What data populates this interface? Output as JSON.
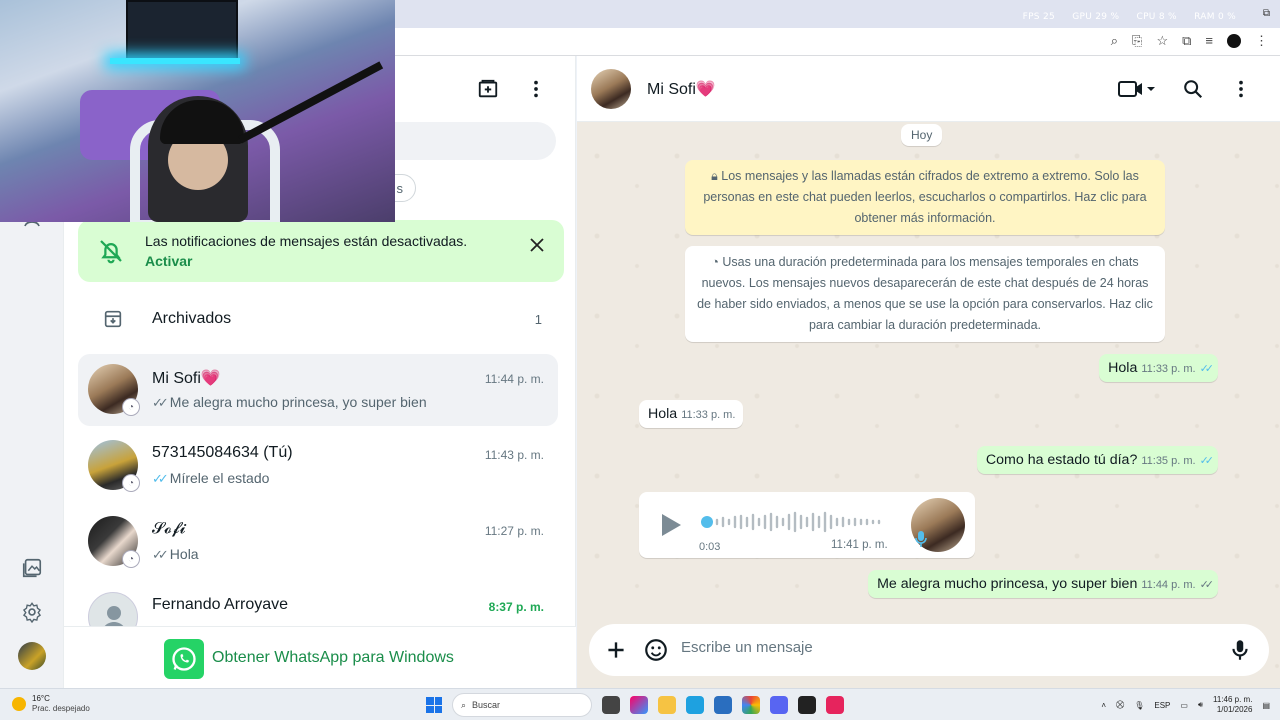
{
  "perf": {
    "fps": "FPS 25",
    "gpu": "GPU 29 %",
    "cpu": "CPU 8 %",
    "ram": "RAM 0 %"
  },
  "sidebar": {
    "active_chat_status": ""
  },
  "list": {
    "filter_chip": "s",
    "notification": {
      "text": "Las notificaciones de mensajes están desactivadas.",
      "action": "Activar"
    },
    "archived": {
      "label": "Archivados",
      "count": "1"
    },
    "chats": [
      {
        "name": "Mi Sofi💗",
        "time": "11:44 p. m.",
        "preview": "Me alegra mucho princesa, yo super bien",
        "ticks": "gray"
      },
      {
        "name": "573145084634 (Tú)",
        "time": "11:43 p. m.",
        "preview": "Mírele el estado",
        "ticks": "blue"
      },
      {
        "name": "𝓢𝓸𝓯𝓲",
        "time": "11:27 p. m.",
        "preview": "Hola",
        "ticks": "gray"
      },
      {
        "name": "Fernando Arroyave",
        "time": "8:37 p. m.",
        "preview": "",
        "ticks": ""
      }
    ],
    "get_whatsapp": "Obtener WhatsApp para Windows"
  },
  "conversation": {
    "contact_name": "Mi Sofi💗",
    "day": "Hoy",
    "encryption_note": "Los mensajes y las llamadas están cifrados de extremo a extremo. Solo las personas en este chat pueden leerlos, escucharlos o compartirlos. Haz clic para obtener más información.",
    "temporary_note": "Usas una duración predeterminada para los mensajes temporales en chats nuevos. Los mensajes nuevos desaparecerán de este chat después de 24 horas de haber sido enviados, a menos que se use la opción para conservarlos. Haz clic para cambiar la duración predeterminada.",
    "messages": [
      {
        "dir": "out",
        "text": "Hola",
        "time": "11:33 p. m."
      },
      {
        "dir": "in",
        "text": "Hola",
        "time": "11:33 p. m."
      },
      {
        "dir": "out",
        "text": "Como ha estado tú día?",
        "time": "11:35 p. m."
      },
      {
        "dir": "out",
        "text": "Me alegra mucho princesa, yo super bien",
        "time": "11:44 p. m."
      }
    ],
    "voice_note": {
      "duration": "0:03",
      "time": "11:41 p. m."
    },
    "composer_placeholder": "Escribe un mensaje"
  },
  "taskbar": {
    "weather_temp": "16°C",
    "weather_desc": "Prac. despejado",
    "search": "Buscar",
    "lang": "ESP",
    "time": "11:46 p. m.",
    "date": "1/01/2026"
  },
  "colors": {
    "accent": "#25d366",
    "outgoing": "#d9fdd3",
    "read_ticks": "#53bdeb",
    "notif_bg": "#d9fdd3"
  }
}
